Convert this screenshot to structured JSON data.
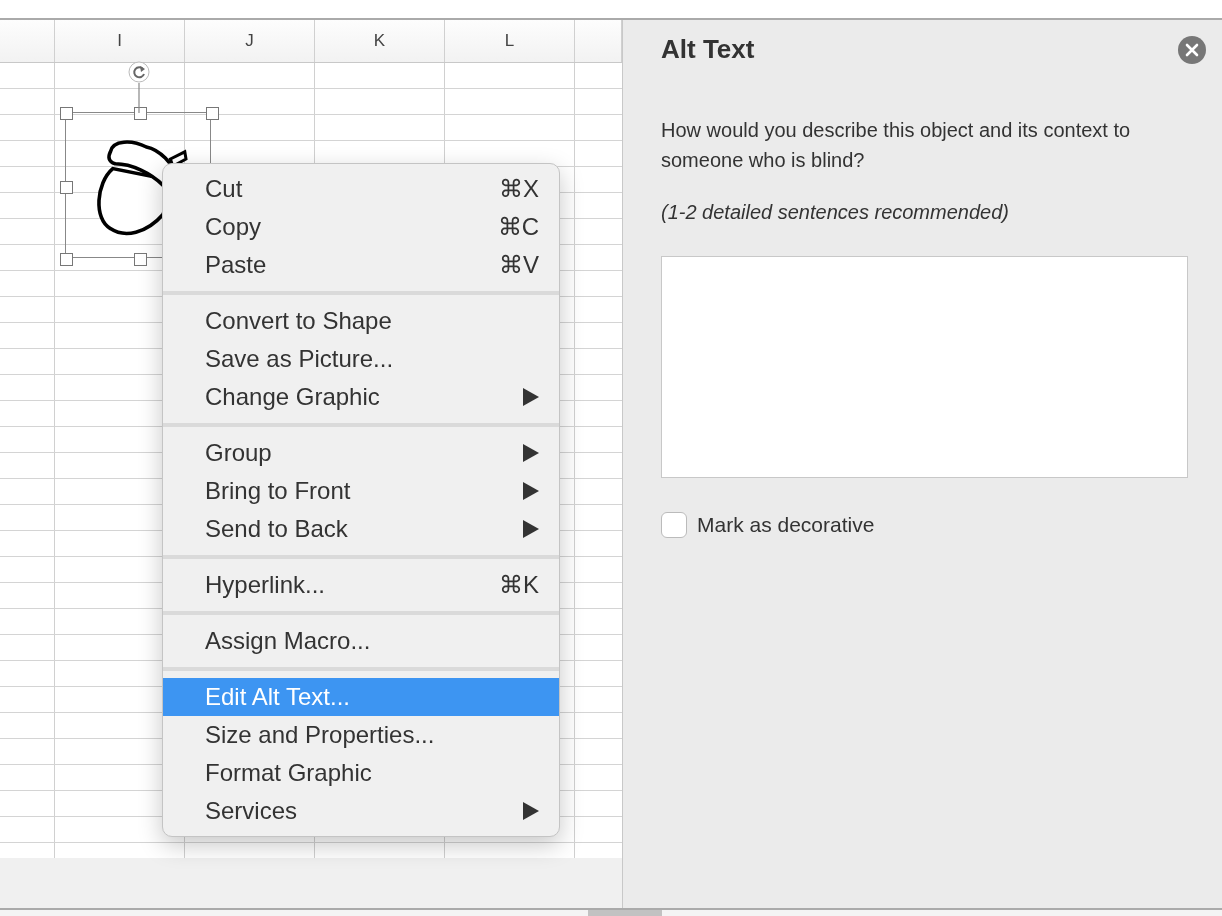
{
  "sheet": {
    "columns": [
      "",
      "I",
      "J",
      "K",
      "L",
      ""
    ],
    "selected_object": true
  },
  "context_menu": {
    "groups": [
      [
        {
          "label": "Cut",
          "shortcut": "⌘X",
          "submenu": false,
          "selected": false
        },
        {
          "label": "Copy",
          "shortcut": "⌘C",
          "submenu": false,
          "selected": false
        },
        {
          "label": "Paste",
          "shortcut": "⌘V",
          "submenu": false,
          "selected": false
        }
      ],
      [
        {
          "label": "Convert to Shape",
          "submenu": false,
          "selected": false
        },
        {
          "label": "Save as Picture...",
          "submenu": false,
          "selected": false
        },
        {
          "label": "Change Graphic",
          "submenu": true,
          "selected": false
        }
      ],
      [
        {
          "label": "Group",
          "submenu": true,
          "selected": false
        },
        {
          "label": "Bring to Front",
          "submenu": true,
          "selected": false
        },
        {
          "label": "Send to Back",
          "submenu": true,
          "selected": false
        }
      ],
      [
        {
          "label": "Hyperlink...",
          "shortcut": "⌘K",
          "submenu": false,
          "selected": false
        }
      ],
      [
        {
          "label": "Assign Macro...",
          "submenu": false,
          "selected": false
        }
      ],
      [
        {
          "label": "Edit Alt Text...",
          "submenu": false,
          "selected": true
        },
        {
          "label": "Size and Properties...",
          "submenu": false,
          "selected": false
        },
        {
          "label": "Format Graphic",
          "submenu": false,
          "selected": false
        },
        {
          "label": "Services",
          "submenu": true,
          "selected": false
        }
      ]
    ]
  },
  "alt_text_pane": {
    "title": "Alt Text",
    "prompt": "How would you describe this object and its context to someone who is blind?",
    "hint": "(1-2 detailed sentences recommended)",
    "decorative": {
      "label": "Mark as decorative",
      "checked": false
    }
  }
}
